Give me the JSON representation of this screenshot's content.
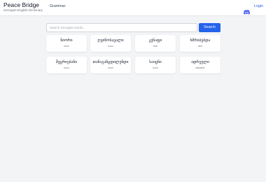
{
  "header": {
    "brand_title": "Peace Bridge",
    "brand_subtitle": "Georgian-English Dictionary",
    "nav_grammar": "Grammar",
    "discord_icon": "discord-icon",
    "login_label": "Login",
    "accent_color": "#2563eb"
  },
  "search": {
    "placeholder": "Search Georgian words...",
    "value": "",
    "button_label": "Search"
  },
  "words": [
    {
      "word": "ნიორი",
      "pos": "noun"
    },
    {
      "word": "ღვინოსავალი",
      "pos": "noun"
    },
    {
      "word": "კენაფი",
      "pos": "verb"
    },
    {
      "word": "ხმრიბებდა",
      "pos": "verb"
    },
    {
      "word": "შეცრიებანი",
      "pos": "noun"
    },
    {
      "word": "თანაგანცდილენდი",
      "pos": "noun"
    },
    {
      "word": "საიცნი",
      "pos": "noun"
    },
    {
      "word": "ადრეული",
      "pos": "adjective"
    }
  ]
}
